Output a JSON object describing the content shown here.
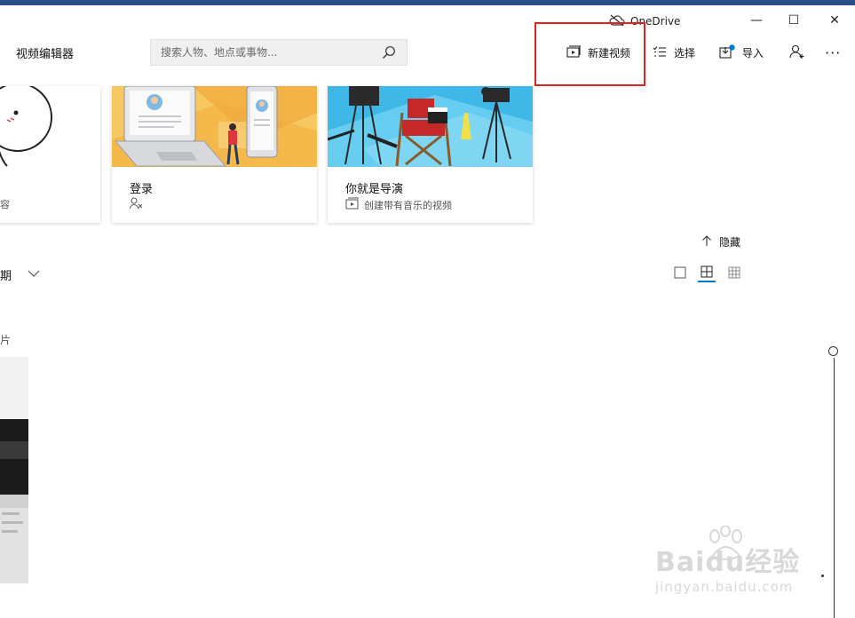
{
  "window": {
    "onedrive_label": "OneDrive",
    "minimize_glyph": "—",
    "maximize_glyph": "☐",
    "close_glyph": "✕"
  },
  "header": {
    "app_title": "视频编辑器",
    "search_placeholder": "搜索人物、地点或事物...",
    "new_video_label": "新建视频",
    "select_label": "选择",
    "import_label": "导入",
    "more_label": "···"
  },
  "cards": [
    {
      "title": "",
      "subtitle": "容"
    },
    {
      "title": "登录",
      "subtitle": ""
    },
    {
      "title": "你就是导演",
      "subtitle": "创建带有音乐的视频"
    }
  ],
  "section": {
    "hide_label": "隐藏",
    "date_label": "期",
    "group_label": "片"
  },
  "watermark": {
    "brand": "Baidu经验",
    "url": "jingyan.baidu.com"
  },
  "colors": {
    "highlight": "#e3211f",
    "accent": "#0078d4",
    "topstrip": "#2b4f86"
  }
}
